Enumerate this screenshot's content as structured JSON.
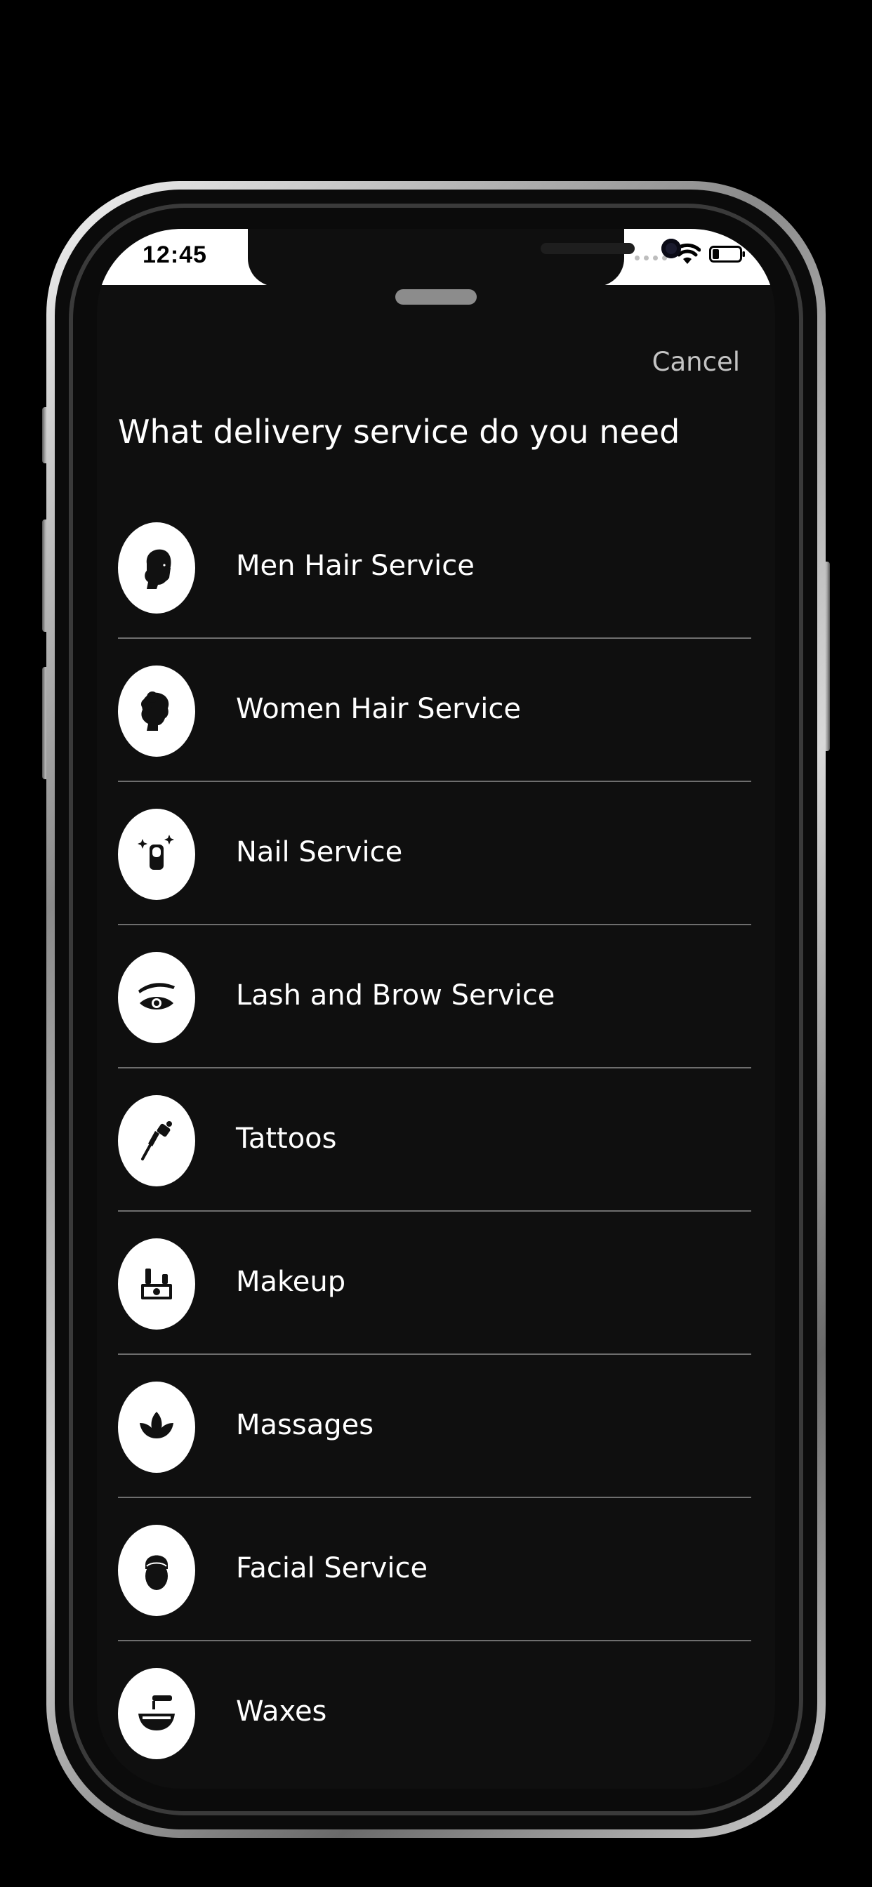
{
  "status_bar": {
    "time": "12:45"
  },
  "sheet": {
    "cancel_label": "Cancel",
    "title": "What delivery service do you need"
  },
  "services": [
    {
      "label": "Men Hair Service",
      "icon": "man-head-icon"
    },
    {
      "label": "Women Hair Service",
      "icon": "woman-head-icon"
    },
    {
      "label": "Nail Service",
      "icon": "nail-icon"
    },
    {
      "label": "Lash and Brow Service",
      "icon": "eye-brow-icon"
    },
    {
      "label": "Tattoos",
      "icon": "tattoo-gun-icon"
    },
    {
      "label": "Makeup",
      "icon": "makeup-kit-icon"
    },
    {
      "label": "Massages",
      "icon": "lotus-icon"
    },
    {
      "label": "Facial Service",
      "icon": "facial-mask-icon"
    },
    {
      "label": "Waxes",
      "icon": "wax-bowl-icon"
    }
  ],
  "colors": {
    "background": "#000000",
    "screen": "#0f0f0f",
    "text": "#ffffff",
    "cancel": "#c4c4c4",
    "divider": "#6e6e6e"
  }
}
